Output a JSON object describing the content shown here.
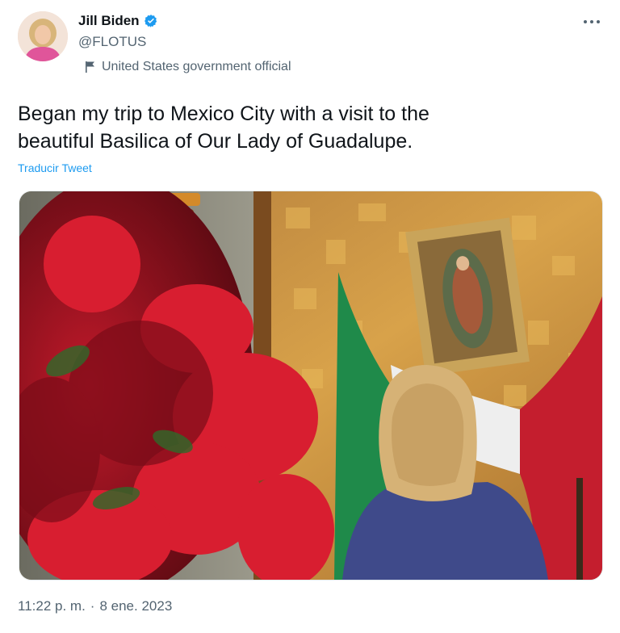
{
  "author": {
    "display_name": "Jill Biden",
    "handle": "@FLOTUS",
    "label": "United States government official",
    "verified_badge_color": "#1d9bf0"
  },
  "tweet": {
    "line1": "Began my trip to Mexico City with a visit to the",
    "line2": "beautiful Basilica of Our Lady of Guadalupe.",
    "translate_link": "Traducir Tweet",
    "time": "11:22 p. m.",
    "separator": "·",
    "date": "8 ene. 2023"
  },
  "icons": {
    "more": "more-horizontal-icon",
    "verified": "verified-badge-icon",
    "label": "flag-icon"
  },
  "colors": {
    "text_primary": "#0f1419",
    "text_secondary": "#536471",
    "link": "#1d9bf0"
  }
}
